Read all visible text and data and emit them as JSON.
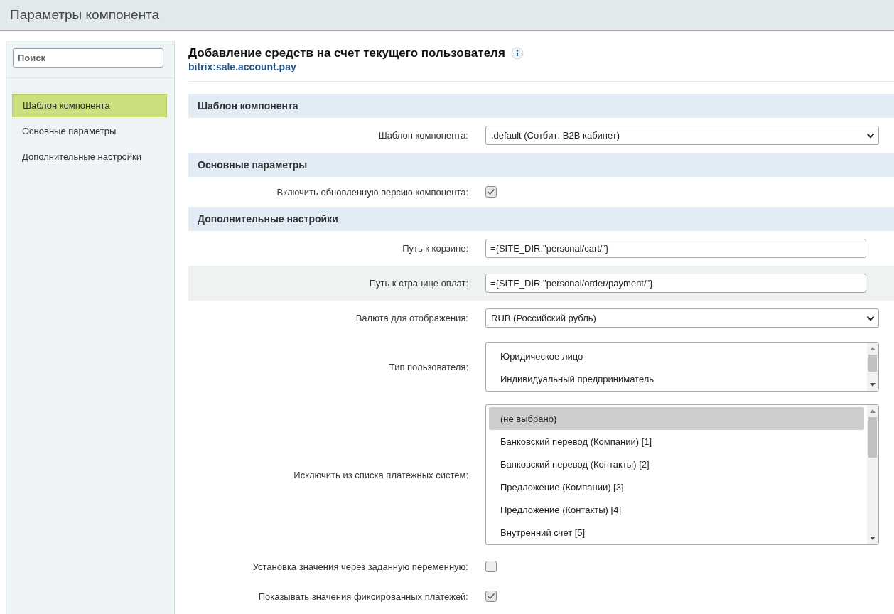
{
  "header": {
    "title": "Параметры компонента"
  },
  "sidebar": {
    "search": {
      "placeholder": "Поиск"
    },
    "items": [
      {
        "label": "Шаблон компонента",
        "selected": true
      },
      {
        "label": "Основные параметры",
        "selected": false
      },
      {
        "label": "Дополнительные настройки",
        "selected": false
      }
    ]
  },
  "component": {
    "title": "Добавление средств на счет текущего пользователя",
    "code": "bitrix:sale.account.pay"
  },
  "sections": [
    {
      "title": "Шаблон компонента",
      "fields": [
        {
          "kind": "select",
          "label": "Шаблон компонента:",
          "value": ".default (Сотбит: B2B кабинет)"
        }
      ]
    },
    {
      "title": "Основные параметры",
      "fields": [
        {
          "kind": "checkbox",
          "label": "Включить обновленную версию компонента:",
          "checked": true
        }
      ]
    },
    {
      "title": "Дополнительные настройки",
      "fields": [
        {
          "kind": "text",
          "label": "Путь к корзине:",
          "value": "={SITE_DIR.\"personal/cart/\"}"
        },
        {
          "kind": "text",
          "label": "Путь к странице оплат:",
          "value": "={SITE_DIR.\"personal/order/payment/\"}",
          "highlighted": true
        },
        {
          "kind": "select",
          "label": "Валюта для отображения:",
          "value": "RUB (Российский рубль)"
        },
        {
          "kind": "multiselect",
          "label": "Тип пользователя:",
          "options": [
            {
              "label": "Юридическое лицо",
              "selected": false
            },
            {
              "label": "Индивидуальный предприниматель",
              "selected": false
            }
          ]
        },
        {
          "kind": "multiselect",
          "label": "Исключить из списка платежных систем:",
          "options": [
            {
              "label": "(не выбрано)",
              "selected": true
            },
            {
              "label": "Банковский перевод (Компании) [1]",
              "selected": false
            },
            {
              "label": "Банковский перевод (Контакты) [2]",
              "selected": false
            },
            {
              "label": "Предложение (Компании) [3]",
              "selected": false
            },
            {
              "label": "Предложение (Контакты) [4]",
              "selected": false
            },
            {
              "label": "Внутренний счет [5]",
              "selected": false
            }
          ]
        },
        {
          "kind": "checkbox",
          "label": "Установка значения через заданную переменную:",
          "checked": false
        },
        {
          "kind": "checkbox",
          "label": "Показывать значения фиксированных платежей:",
          "checked": true
        }
      ]
    }
  ]
}
